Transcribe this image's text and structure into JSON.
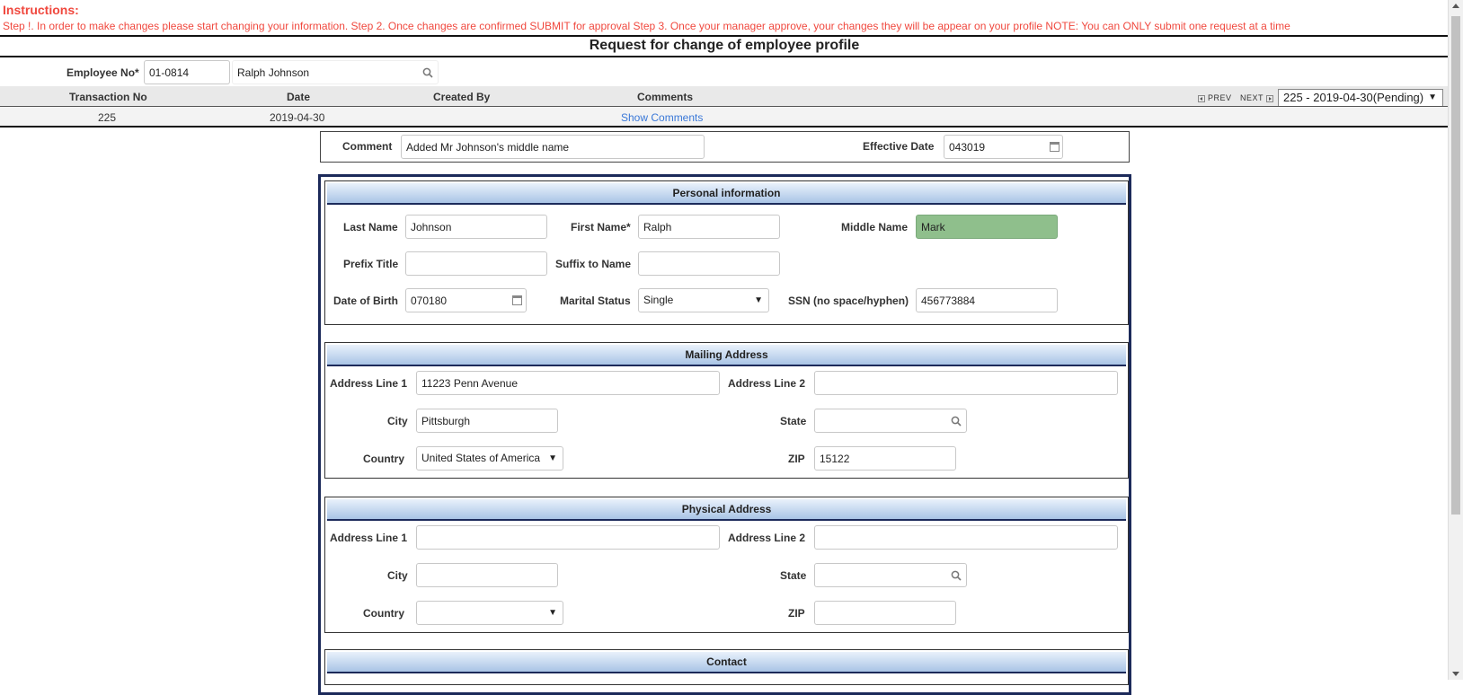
{
  "instructions": {
    "title": "Instructions:",
    "text": "Step !. In order to make changes please start changing your information. Step 2. Once changes are confirmed SUBMIT for approval Step 3. Once your manager approve, your changes they will be appear on your profile NOTE: You can ONLY submit one request at a time"
  },
  "page_title": "Request for change of employee profile",
  "employee": {
    "label": "Employee No*",
    "number": "01-0814",
    "name": "Ralph Johnson"
  },
  "transactions": {
    "headers": [
      "Transaction No",
      "Date",
      "Created By",
      "Comments"
    ],
    "row": {
      "transaction_no": "225",
      "date": "2019-04-30",
      "created_by": "",
      "comments_link": "Show Comments"
    },
    "pager": {
      "prev": "PREV",
      "next": "NEXT"
    },
    "selected": "225 - 2019-04-30(Pending)"
  },
  "request": {
    "comment_label": "Comment",
    "comment_value": "Added Mr Johnson's middle name",
    "effective_label": "Effective Date",
    "effective_value": "043019"
  },
  "personal": {
    "header": "Personal information",
    "last_name_label": "Last Name",
    "last_name": "Johnson",
    "first_name_label": "First Name*",
    "first_name": "Ralph",
    "middle_name_label": "Middle Name",
    "middle_name": "Mark",
    "prefix_label": "Prefix Title",
    "prefix": "",
    "suffix_label": "Suffix to Name",
    "suffix": "",
    "dob_label": "Date of Birth",
    "dob": "070180",
    "marital_label": "Marital Status",
    "marital": "Single",
    "ssn_label": "SSN (no space/hyphen)",
    "ssn": "456773884"
  },
  "mailing": {
    "header": "Mailing Address",
    "addr1_label": "Address Line 1",
    "addr1": "11223 Penn Avenue",
    "addr2_label": "Address Line 2",
    "addr2": "",
    "city_label": "City",
    "city": "Pittsburgh",
    "state_label": "State",
    "state": "",
    "country_label": "Country",
    "country": "United States of America",
    "zip_label": "ZIP",
    "zip": "15122"
  },
  "physical": {
    "header": "Physical Address",
    "addr1_label": "Address Line 1",
    "addr1": "",
    "addr2_label": "Address Line 2",
    "addr2": "",
    "city_label": "City",
    "city": "",
    "state_label": "State",
    "state": "",
    "country_label": "Country",
    "country": "",
    "zip_label": "ZIP",
    "zip": ""
  },
  "contact": {
    "header": "Contact"
  },
  "colors": {
    "instruction_red": "#f0483e",
    "highlight_green": "#8fbf8c",
    "link_blue": "#3a78d8",
    "section_border": "#1c2a5a"
  }
}
